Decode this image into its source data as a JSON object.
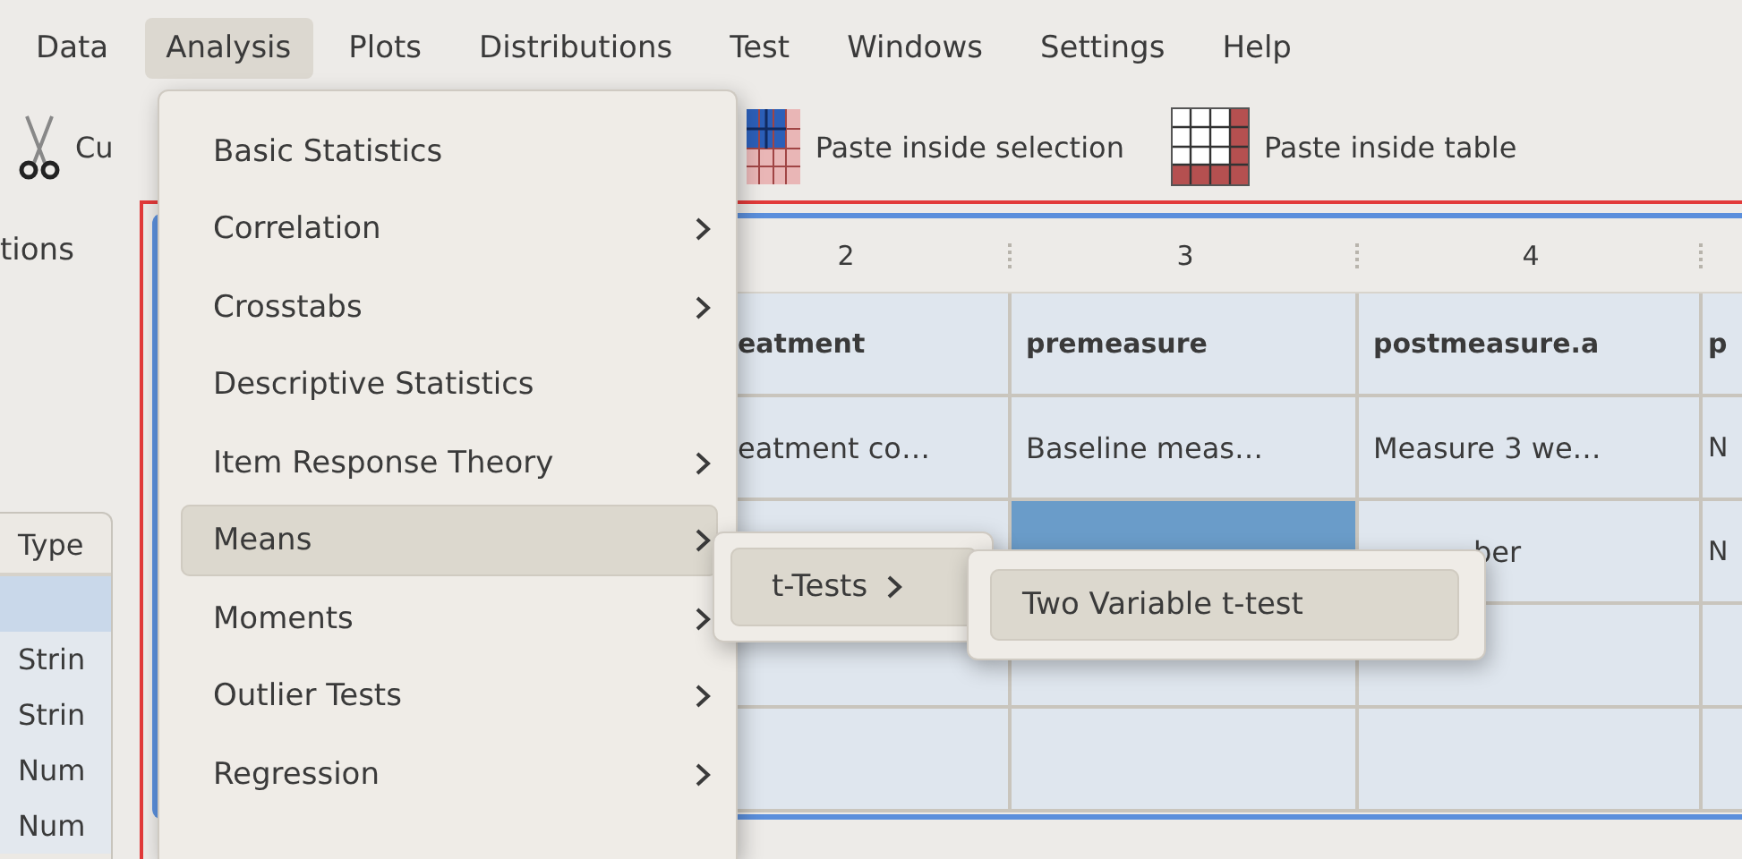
{
  "menubar": [
    {
      "label": "Data",
      "selected": false
    },
    {
      "label": "Analysis",
      "selected": true
    },
    {
      "label": "Plots",
      "selected": false
    },
    {
      "label": "Distributions",
      "selected": false
    },
    {
      "label": "Test",
      "selected": false
    },
    {
      "label": "Windows",
      "selected": false
    },
    {
      "label": "Settings",
      "selected": false
    },
    {
      "label": "Help",
      "selected": false
    }
  ],
  "toolbar": [
    {
      "kind": "cut",
      "label": "Cu"
    },
    {
      "kind": "paste_selection",
      "label": "Paste inside selection"
    },
    {
      "kind": "paste_table",
      "label": "Paste inside table"
    }
  ],
  "side_panel": {
    "label": "tions",
    "column_header": "Type",
    "rows": [
      {
        "selected": true
      },
      {
        "text": "Strin",
        "selected": false
      },
      {
        "text": "Strin",
        "selected": false
      },
      {
        "text": "Num",
        "selected": false
      },
      {
        "text": "Num",
        "selected": false
      }
    ]
  },
  "table": {
    "columns": [
      "2",
      "3",
      "4"
    ],
    "rows": [
      {
        "kind": "header",
        "cells": [
          {
            "text": "eatment"
          },
          {
            "text": "premeasure"
          },
          {
            "text": "postmeasure.a"
          },
          {
            "text": "p"
          }
        ]
      },
      {
        "kind": "data",
        "cells": [
          {
            "text": "eatment co…",
            "selected": false
          },
          {
            "text": "Baseline meas…",
            "selected": false
          },
          {
            "text": "Measure 3 we…",
            "selected": false
          },
          {
            "text": "N",
            "selected": false
          }
        ]
      },
      {
        "kind": "data",
        "cells": [
          {
            "selected": false
          },
          {
            "selected": true
          },
          {
            "text": "ber",
            "selected": false
          },
          {
            "text": "N",
            "selected": false
          }
        ]
      },
      {
        "kind": "data",
        "cells": [
          {
            "selected": false
          },
          {
            "selected": false
          },
          {
            "selected": false
          },
          {
            "selected": false
          }
        ]
      },
      {
        "kind": "data",
        "cells": [
          {
            "selected": false
          },
          {
            "selected": false
          },
          {
            "selected": false
          },
          {
            "selected": false
          }
        ]
      }
    ]
  },
  "analysis_menu": {
    "items": [
      {
        "label": "Basic Statistics",
        "submenu": false,
        "selected": false
      },
      {
        "label": "Correlation",
        "submenu": true,
        "selected": false
      },
      {
        "label": "Crosstabs",
        "submenu": true,
        "selected": false
      },
      {
        "label": "Descriptive Statistics",
        "submenu": false,
        "selected": false
      },
      {
        "label": "Item Response Theory",
        "submenu": true,
        "selected": false
      },
      {
        "label": "Means",
        "submenu": true,
        "selected": true
      },
      {
        "label": "Moments",
        "submenu": true,
        "selected": false
      },
      {
        "label": "Outlier Tests",
        "submenu": true,
        "selected": false
      },
      {
        "label": "Regression",
        "submenu": true,
        "selected": false
      }
    ]
  },
  "means_submenu": {
    "items": [
      {
        "label": "t-Tests",
        "submenu": true,
        "selected": true
      }
    ]
  },
  "t_tests_submenu": {
    "items": [
      {
        "label": "Two Variable t-test",
        "submenu": false,
        "selected": true
      }
    ]
  }
}
